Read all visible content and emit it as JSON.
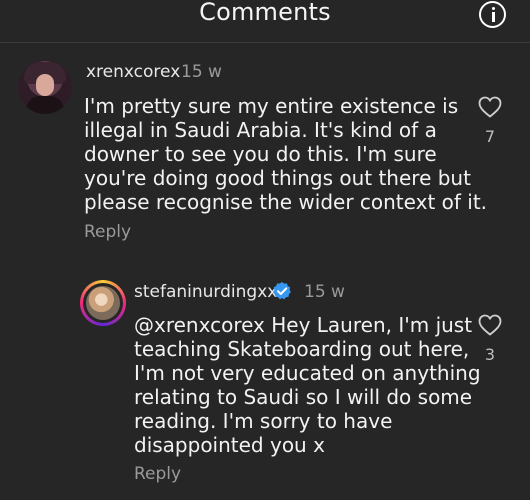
{
  "header": {
    "title": "Comments"
  },
  "comments": [
    {
      "username": "xrenxcorex",
      "time": "15 w",
      "lines": [
        "I'm pretty sure my entire existence is",
        "illegal in Saudi Arabia. It's kind of a",
        "downer to see you do this. I'm sure",
        "you're doing good things out there but",
        "please recognise the wider context of it."
      ],
      "reply_label": "Reply",
      "likes": "7"
    },
    {
      "username": "stefaninurdingxx",
      "verified": true,
      "time": "15 w",
      "lines": [
        "@xrenxcorex Hey Lauren, I'm just",
        "teaching Skateboarding out here,",
        "I'm not very educated on anything",
        "relating to Saudi so I will do some",
        "reading.  I'm sorry to have",
        "disappointed you x"
      ],
      "reply_label": "Reply",
      "likes": "3"
    }
  ],
  "colors": {
    "background": "#262626",
    "verified_badge": "#3897f0"
  },
  "icons": {
    "info": "info-icon",
    "like": "heart-icon",
    "verified": "verified-badge-icon"
  }
}
